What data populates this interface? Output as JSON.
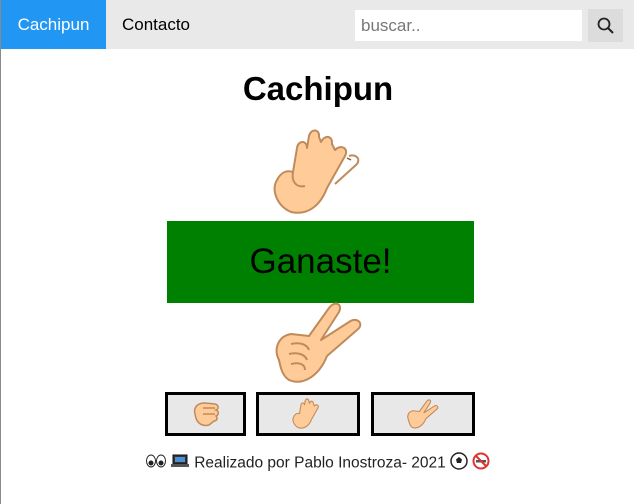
{
  "nav": {
    "brand": "Cachipun",
    "contact": "Contacto",
    "search_placeholder": "buscar.."
  },
  "main": {
    "title": "Cachipun",
    "result": "Ganaste!"
  },
  "hands": {
    "computer": "paper-hand-icon",
    "player": "scissors-hand-icon"
  },
  "choices": [
    "rock-hand-icon",
    "paper-hand-icon",
    "scissors-hand-icon"
  ],
  "footer": {
    "text": "Realizado por Pablo Inostroza- 2021"
  },
  "colors": {
    "nav_active": "#2196f3",
    "nav_bg": "#e9e9e9",
    "result_bg": "#008000",
    "skin": "#ffcc99"
  }
}
